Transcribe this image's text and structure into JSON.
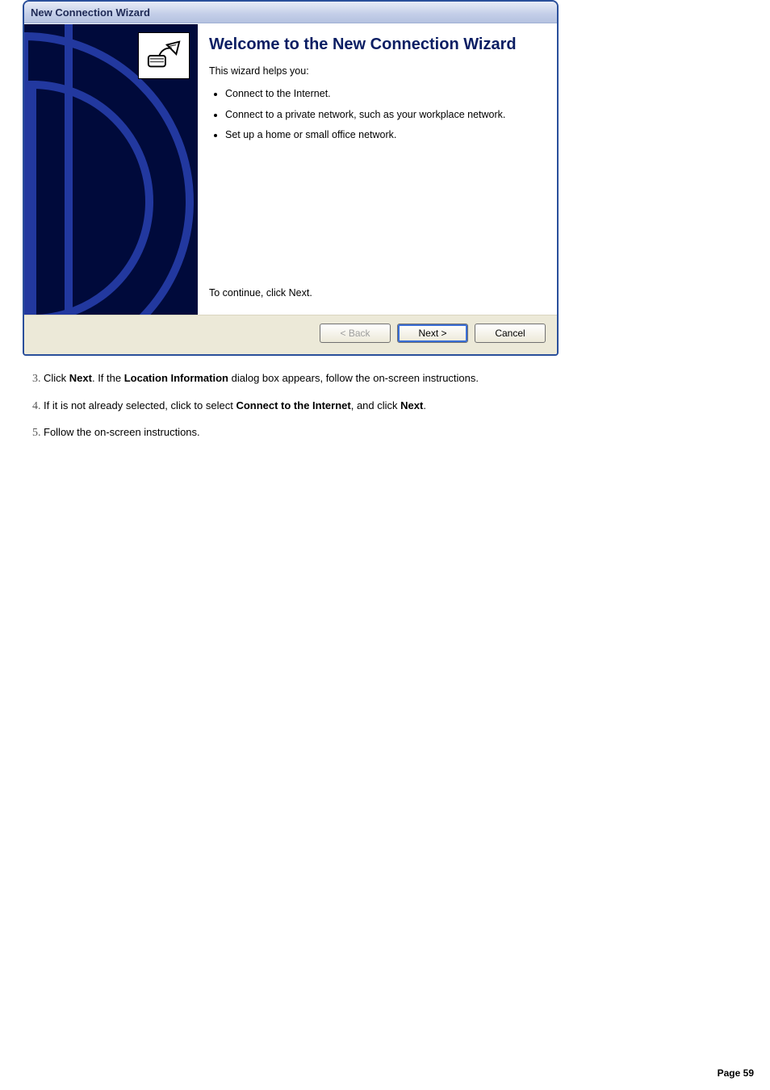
{
  "dialog": {
    "title": "New Connection Wizard",
    "heading": "Welcome to the New Connection Wizard",
    "intro": "This wizard helps you:",
    "bullets": [
      "Connect to the Internet.",
      "Connect to a private network, such as your workplace network.",
      "Set up a home or small office network."
    ],
    "continue_text": "To continue, click Next.",
    "buttons": {
      "back": "< Back",
      "next": "Next >",
      "cancel": "Cancel"
    }
  },
  "steps": {
    "start": 3,
    "items": [
      {
        "parts": [
          {
            "t": "Click "
          },
          {
            "t": "Next",
            "bold": true
          },
          {
            "t": ". If the "
          },
          {
            "t": "Location Information",
            "bold": true
          },
          {
            "t": " dialog box appears, follow the on-screen instructions."
          }
        ]
      },
      {
        "parts": [
          {
            "t": "If it is not already selected, click to select "
          },
          {
            "t": "Connect to the Internet",
            "bold": true
          },
          {
            "t": ", and click "
          },
          {
            "t": "Next",
            "bold": true
          },
          {
            "t": "."
          }
        ]
      },
      {
        "parts": [
          {
            "t": "Follow the on-screen instructions."
          }
        ]
      }
    ]
  },
  "footer": {
    "page_label": "Page 59"
  }
}
